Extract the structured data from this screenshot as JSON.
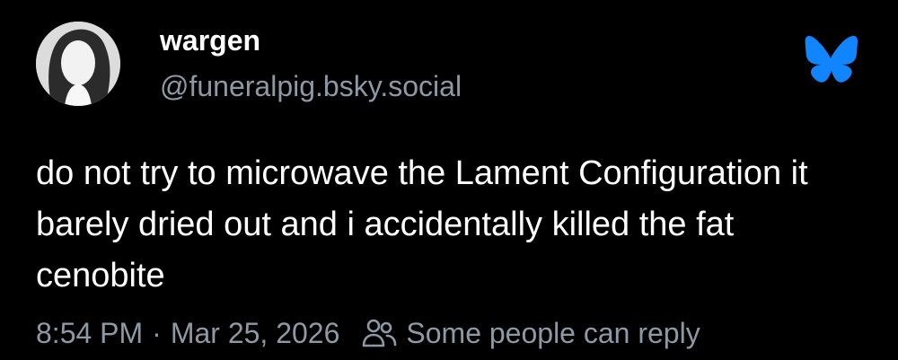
{
  "post": {
    "author": {
      "display_name": "wargen",
      "handle": "@funeralpig.bsky.social",
      "avatar_icon": "profile-photo"
    },
    "platform_icon": "bluesky-butterfly-icon",
    "text": "do not try to microwave the Lament Configuration it barely dried out and i accidentally killed the fat cenobite",
    "time": "8:54 PM",
    "separator": "·",
    "date": "Mar 25, 2026",
    "reply_icon": "people-icon",
    "reply_setting": "Some people can reply"
  },
  "colors": {
    "background": "#000000",
    "text": "#ffffff",
    "muted": "#8e99a6",
    "brand": "#1185fe"
  }
}
